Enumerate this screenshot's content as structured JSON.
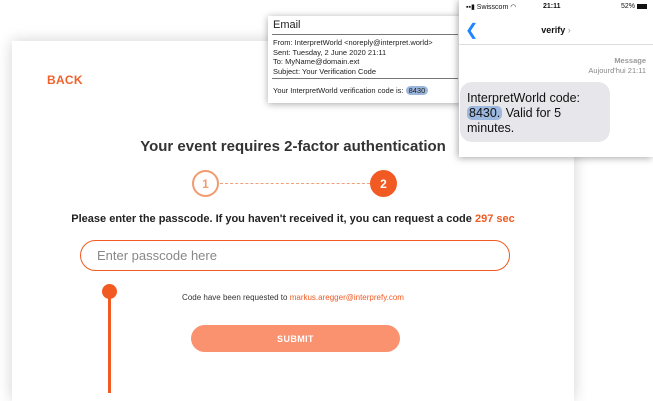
{
  "card": {
    "back_label": "BACK",
    "title": "Your event requires 2-factor authentication",
    "steps": [
      "1",
      "2"
    ],
    "prompt_text": "Please enter the passcode. If you haven't received it, you can request a code",
    "timer": "297 sec",
    "passcode_placeholder": "Enter passcode here",
    "requested_text": "Code have been requested to",
    "requested_email": "markus.aregger@interprefy.com",
    "submit_label": "SUBMIT"
  },
  "email": {
    "window_title": "Email",
    "from": "From: InterpretWorld <noreply@interpret.world>",
    "sent": "Sent: Tuesday, 2 June 2020 21:11",
    "to": "To: MyName@domain.ext",
    "subject": "Subject: Your Verification Code",
    "body_text": "Your InterpretWorld verification code is:",
    "code": "8430"
  },
  "phone": {
    "carrier": "Swisscom",
    "time": "21:11",
    "battery": "52%",
    "thread_title": "verify",
    "meta_label": "Message",
    "meta_time": "Aujourd'hui 21:11",
    "msg_part1": "InterpretWorld code:",
    "msg_code": "8430.",
    "msg_part2": "Valid for 5 minutes."
  },
  "colors": {
    "accent": "#f15a22",
    "submit_bg": "#fa9270",
    "highlight": "#9bb6dd",
    "ios_blue": "#1f84ff"
  }
}
